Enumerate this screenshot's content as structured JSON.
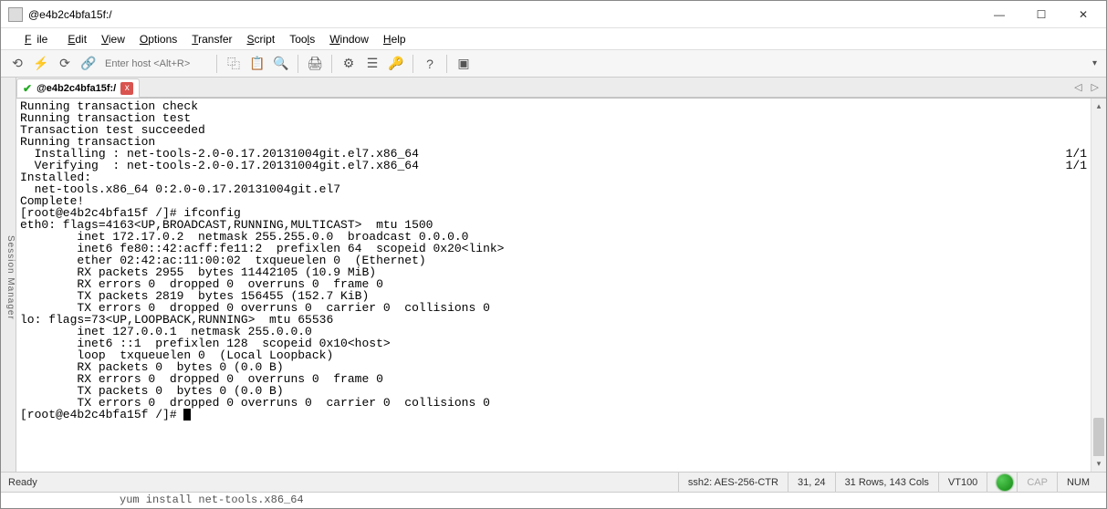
{
  "window": {
    "title": "@e4b2c4bfa15f:/",
    "minimize": "—",
    "maximize": "☐",
    "close": "✕"
  },
  "menu": {
    "file": "File",
    "edit": "Edit",
    "view": "View",
    "options": "Options",
    "transfer": "Transfer",
    "script": "Script",
    "tools": "Tools",
    "window": "Window",
    "help": "Help"
  },
  "toolbar": {
    "host_placeholder": "Enter host <Alt+R>"
  },
  "session_manager_label": "Session Manager",
  "tab": {
    "title": "@e4b2c4bfa15f:/",
    "close": "x",
    "nav_left": "◁",
    "nav_right": "▷"
  },
  "terminal": {
    "lines": [
      "Running transaction check",
      "Running transaction test",
      "Transaction test succeeded",
      "Running transaction",
      "  Installing : net-tools-2.0-0.17.20131004git.el7.x86_64",
      "  Verifying  : net-tools-2.0-0.17.20131004git.el7.x86_64",
      "",
      "Installed:",
      "  net-tools.x86_64 0:2.0-0.17.20131004git.el7",
      "",
      "Complete!",
      "[root@e4b2c4bfa15f /]# ifconfig",
      "eth0: flags=4163<UP,BROADCAST,RUNNING,MULTICAST>  mtu 1500",
      "        inet 172.17.0.2  netmask 255.255.0.0  broadcast 0.0.0.0",
      "        inet6 fe80::42:acff:fe11:2  prefixlen 64  scopeid 0x20<link>",
      "        ether 02:42:ac:11:00:02  txqueuelen 0  (Ethernet)",
      "        RX packets 2955  bytes 11442105 (10.9 MiB)",
      "        RX errors 0  dropped 0  overruns 0  frame 0",
      "        TX packets 2819  bytes 156455 (152.7 KiB)",
      "        TX errors 0  dropped 0 overruns 0  carrier 0  collisions 0",
      "",
      "lo: flags=73<UP,LOOPBACK,RUNNING>  mtu 65536",
      "        inet 127.0.0.1  netmask 255.0.0.0",
      "        inet6 ::1  prefixlen 128  scopeid 0x10<host>",
      "        loop  txqueuelen 0  (Local Loopback)",
      "        RX packets 0  bytes 0 (0.0 B)",
      "        RX errors 0  dropped 0  overruns 0  frame 0",
      "        TX packets 0  bytes 0 (0.0 B)",
      "        TX errors 0  dropped 0 overruns 0  carrier 0  collisions 0",
      ""
    ],
    "right_counts": [
      "1/1",
      "1/1"
    ],
    "prompt": "[root@e4b2c4bfa15f /]# "
  },
  "status": {
    "ready": "Ready",
    "protocol": "ssh2: AES-256-CTR",
    "cursor": "31, 24",
    "size": "31 Rows, 143 Cols",
    "term": "VT100",
    "cap": "CAP",
    "num": "NUM"
  },
  "extra_line": "yum install net-tools.x86_64"
}
